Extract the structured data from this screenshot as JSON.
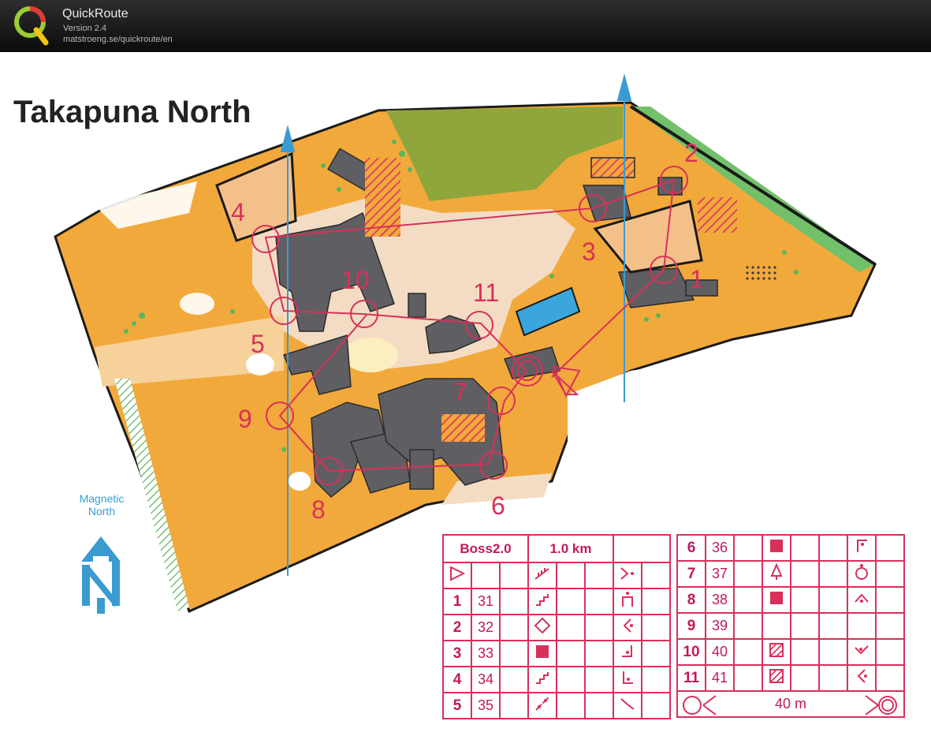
{
  "app": {
    "name": "QuickRoute",
    "version": "Version 2.4",
    "url": "matstroeng.se/quickroute/en"
  },
  "map": {
    "title": "Takapuna North",
    "magnetic_north": [
      "Magnetic",
      "North"
    ],
    "control_labels": [
      {
        "n": "1"
      },
      {
        "n": "2"
      },
      {
        "n": "3"
      },
      {
        "n": "4"
      },
      {
        "n": "5"
      },
      {
        "n": "6"
      },
      {
        "n": "7"
      },
      {
        "n": "8"
      },
      {
        "n": "9"
      },
      {
        "n": "10"
      },
      {
        "n": "11"
      }
    ]
  },
  "descriptions": {
    "course": "Boss2.0",
    "length": "1.0 km",
    "left_rows": [
      {
        "num": "1",
        "code": "31",
        "feature": "steps-icon",
        "detail": "pillar-icon"
      },
      {
        "num": "2",
        "code": "32",
        "feature": "diamond-icon",
        "detail": "west-corner-icon"
      },
      {
        "num": "3",
        "code": "33",
        "feature": "square-icon",
        "detail": "east-corner-icon"
      },
      {
        "num": "4",
        "code": "34",
        "feature": "steps-icon",
        "detail": "south-corner-icon"
      },
      {
        "num": "5",
        "code": "35",
        "feature": "path-icon",
        "detail": "bend-icon"
      }
    ],
    "right_rows": [
      {
        "num": "6",
        "code": "36",
        "feature": "square-icon",
        "detail": "corner-top-icon"
      },
      {
        "num": "7",
        "code": "37",
        "feature": "tree-icon",
        "detail": "ring-icon"
      },
      {
        "num": "8",
        "code": "38",
        "feature": "square-icon",
        "detail": "roof-icon"
      },
      {
        "num": "9",
        "code": "39",
        "feature": "",
        "detail": ""
      },
      {
        "num": "10",
        "code": "40",
        "feature": "hatch-icon",
        "detail": "check-icon"
      },
      {
        "num": "11",
        "code": "41",
        "feature": "hatch-icon",
        "detail": "west-corner-icon"
      }
    ],
    "finish_distance": "40 m"
  },
  "colors": {
    "course_magenta": "#d8305a",
    "open_land": "#f2a93b",
    "rough_open": "#f6d19a",
    "building": "#5f5f63",
    "paved": "#f4dcc4",
    "forest_green": "#8ea63b",
    "water": "#3aa6dd",
    "north_line": "#3a9bd1"
  }
}
